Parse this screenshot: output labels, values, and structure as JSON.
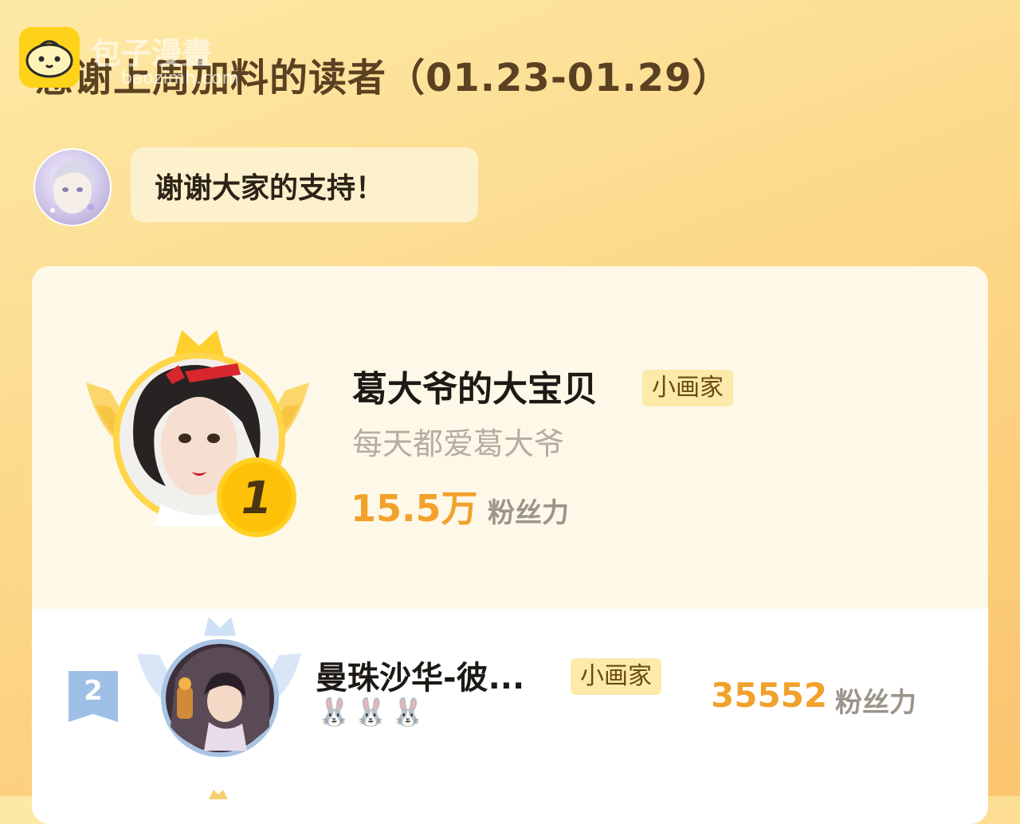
{
  "watermark": {
    "brand": "包子漫畫",
    "url": "baozimh.com"
  },
  "title": "感谢上周加料的读者（01.23-01.29）",
  "author_message": "谢谢大家的支持！",
  "leaderboard": [
    {
      "rank": "1",
      "name": "葛大爷的大宝贝",
      "tag": "小画家",
      "signature": "每天都爱葛大爷",
      "fans_value": "15.5万",
      "fans_label": "粉丝力"
    },
    {
      "rank": "2",
      "name": "曼珠沙华-彼...",
      "tag": "小画家",
      "signature": "🐰🐰🐰",
      "fans_value": "35552",
      "fans_label": "粉丝力"
    }
  ],
  "colors": {
    "accent_gold": "#f2a12b",
    "tag_bg": "#fbeaa8",
    "background_top": "#fde9a6",
    "background_bottom": "#fbc46e"
  },
  "icons": {
    "watermark_logo": "bun-logo-icon",
    "rank1_badge": "gold-crown-wings-icon",
    "rank2_badge": "silver-crown-wings-icon",
    "rank2_flag": "rank-ribbon-icon"
  }
}
